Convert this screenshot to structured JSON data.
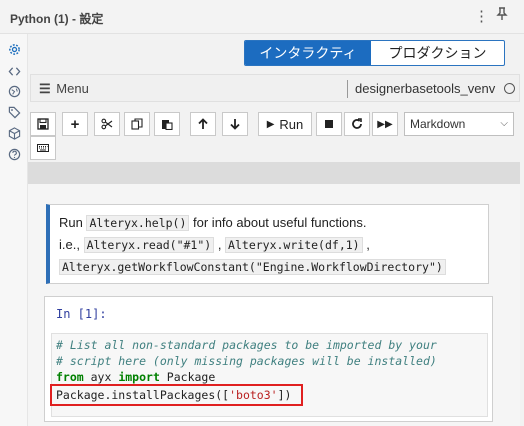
{
  "window": {
    "title": "Python (1) - 設定",
    "more_icon": "vertical-ellipsis-icon",
    "pin_icon": "pin-icon"
  },
  "sidebar": {
    "icons": [
      "gear-icon",
      "code-icon",
      "globe-icon",
      "tag-icon",
      "cube-icon",
      "help-icon"
    ]
  },
  "mode_toggle": {
    "interactive": "インタラクティブ",
    "production": "プロダクション",
    "selected": "interactive"
  },
  "menubar": {
    "menu_label": "Menu",
    "kernel_name": "designerbasetools_venv"
  },
  "toolbar": {
    "run_label": "Run",
    "cell_type": "Markdown",
    "buttons": [
      "save-icon",
      "plus-icon",
      "scissors-icon",
      "copy-icon",
      "paste-icon",
      "arrow-up-icon",
      "arrow-down-icon",
      "play-icon",
      "stop-icon",
      "restart-icon",
      "fast-forward-icon",
      "keyboard-icon"
    ]
  },
  "markdown_cell": {
    "line1_pre": "Run ",
    "line1_code": "Alteryx.help()",
    "line1_post": " for info about useful functions.",
    "line2_pre": "i.e., ",
    "line2_code1": "Alteryx.read(\"#1\")",
    "line2_mid": " , ",
    "line2_code2": "Alteryx.write(df,1)",
    "line2_post": " ,",
    "line3_code": "Alteryx.getWorkflowConstant(\"Engine.WorkflowDirectory\")"
  },
  "code_cell": {
    "prompt": "In [1]:",
    "comment1": "# List all non-standard packages to be imported by your",
    "comment2": "# script here (only missing packages will be installed)",
    "kw_from": "from",
    "module": " ayx ",
    "kw_import": "import",
    "name": " Package",
    "call_pre": "Package.installPackages([",
    "call_str": "'boto3'",
    "call_post": "])"
  },
  "colors": {
    "accent": "#1c6cc0",
    "highlight_box": "#e02020",
    "markdown_border": "#2e6fb7"
  }
}
